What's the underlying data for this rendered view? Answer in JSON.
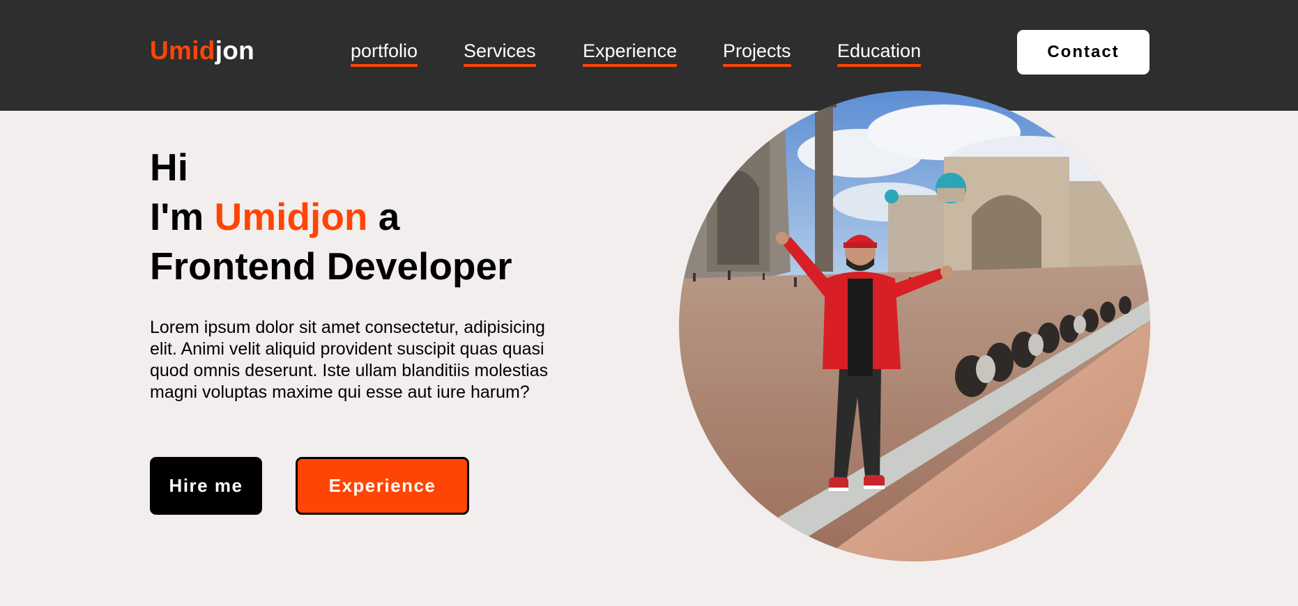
{
  "header": {
    "logo": {
      "part1": "Umid",
      "part2": "jon"
    },
    "nav": [
      "portfolio",
      "Services",
      "Experience",
      "Projects",
      "Education"
    ],
    "contact_label": "Contact"
  },
  "hero": {
    "line1": "Hi",
    "line2_prefix": "I'm ",
    "name": "Umidjon",
    "line2_suffix": " a",
    "line3": "Frontend Developer",
    "description": "Lorem ipsum dolor sit amet consectetur, adipisicing elit. Animi velit aliquid provident suscipit quas quasi quod omnis deserunt. Iste ullam blanditiis molestias magni voluptas maxime qui esse aut iure harum?",
    "hire_label": "Hire me",
    "experience_label": "Experience"
  },
  "colors": {
    "accent": "#ff4506",
    "header_bg": "#2e2e2e",
    "page_bg": "#f2eeed"
  }
}
